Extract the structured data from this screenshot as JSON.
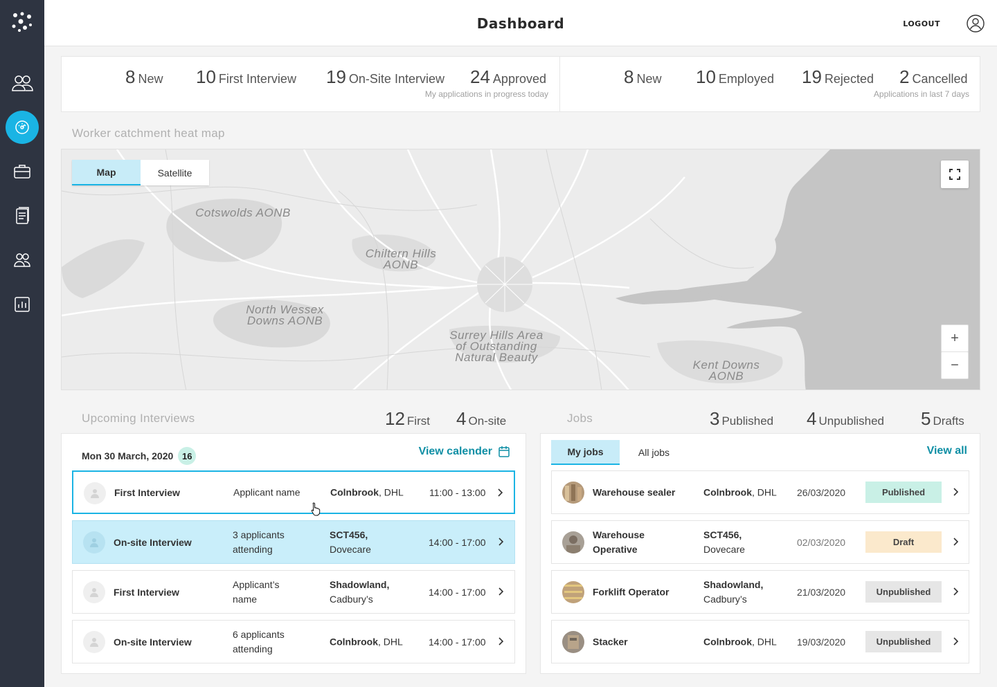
{
  "header": {
    "title": "Dashboard",
    "logout": "LOGOUT"
  },
  "sidebar": {
    "items": [
      "logo-icon",
      "people-icon",
      "dashboard-icon",
      "briefcase-icon",
      "documents-icon",
      "team-icon",
      "reports-icon"
    ],
    "active": "dashboard-icon"
  },
  "stats": {
    "left": [
      {
        "num": "8",
        "label": "New"
      },
      {
        "num": "10",
        "label": "First Interview"
      },
      {
        "num": "19",
        "label": "On-Site Interview"
      },
      {
        "num": "24",
        "label": "Approved"
      }
    ],
    "left_caption": "My applications in progress today",
    "right": [
      {
        "num": "8",
        "label": "New"
      },
      {
        "num": "10",
        "label": "Employed"
      },
      {
        "num": "19",
        "label": "Rejected"
      },
      {
        "num": "2",
        "label": "Cancelled"
      }
    ],
    "right_caption": "Applications in last 7 days"
  },
  "map": {
    "title": "Worker catchment heat map",
    "tabs": [
      "Map",
      "Satellite"
    ],
    "active_tab": "Map",
    "zoom_in": "+",
    "zoom_out": "−",
    "labels": {
      "cotswolds": "Cotswolds AONB",
      "chiltern": "Chiltern Hills AONB",
      "wessex": "North Wessex Downs AONB",
      "surrey": "Surrey Hills Area of Outstanding Natural Beauty",
      "kent": "Kent Downs AONB"
    }
  },
  "interviews": {
    "title": "Upcoming Interviews",
    "counts": [
      {
        "num": "12",
        "label": "First"
      },
      {
        "num": "4",
        "label": "On-site"
      }
    ],
    "date": "Mon 30 March, 2020",
    "date_count": "16",
    "view_calendar": "View calender",
    "rows": [
      {
        "type": "First Interview",
        "who": "Applicant name",
        "place": "Colnbrook",
        "company": ", DHL",
        "time": "11:00 - 13:00"
      },
      {
        "type": "On-site Interview",
        "who": "3 applicants attending",
        "place": "SCT456,",
        "company": "Dovecare",
        "time": "14:00 - 17:00"
      },
      {
        "type": "First Interview",
        "who": "Applicant’s name",
        "place": "Shadowland,",
        "company": "Cadbury’s",
        "time": "14:00 - 17:00"
      },
      {
        "type": "On-site Interview",
        "who": "6 applicants attending",
        "place": "Colnbrook",
        "company": ", DHL",
        "time": "14:00 - 17:00"
      }
    ]
  },
  "jobs": {
    "title": "Jobs",
    "counts": [
      {
        "num": "3",
        "label": "Published"
      },
      {
        "num": "4",
        "label": "Unpublished"
      },
      {
        "num": "5",
        "label": "Drafts"
      }
    ],
    "tabs": [
      "My jobs",
      "All jobs"
    ],
    "view_all": "View all",
    "rows": [
      {
        "title": "Warehouse sealer",
        "place": "Colnbrook",
        "company": ", DHL",
        "date": "26/03/2020",
        "status": "Published",
        "status_color": "#c9f0e6"
      },
      {
        "title": "Warehouse Operative",
        "place": "SCT456,",
        "company": "Dovecare",
        "date": "02/03/2020",
        "status": "Draft",
        "status_color": "#fbe9cc"
      },
      {
        "title": "Forklift Operator",
        "place": "Shadowland,",
        "company": "Cadbury’s",
        "date": "21/03/2020",
        "status": "Unpublished",
        "status_color": "#e6e6e6"
      },
      {
        "title": "Stacker",
        "place": "Colnbrook",
        "company": ", DHL",
        "date": "19/03/2020",
        "status": "Unpublished",
        "status_color": "#e6e6e6"
      }
    ]
  },
  "colors": {
    "accent": "#1ab4e4",
    "sidebar": "#2e3441",
    "teal_link": "#0f8fa5"
  }
}
